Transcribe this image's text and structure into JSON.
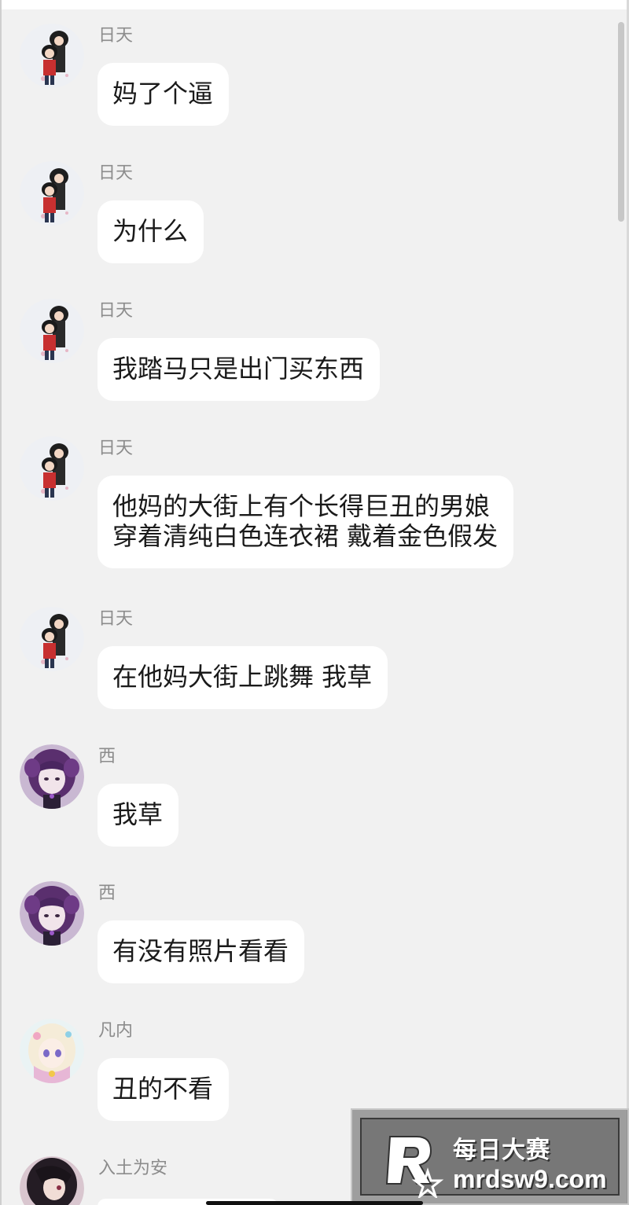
{
  "colors": {
    "background": "#f1f1f1",
    "bubble": "#ffffff",
    "name_text": "#8c8c8c",
    "message_text": "#1a1a1a"
  },
  "messages": [
    {
      "sender": "日天",
      "avatar": "chibi-couple-avatar",
      "lines": [
        "妈了个逼"
      ]
    },
    {
      "sender": "日天",
      "avatar": "chibi-couple-avatar",
      "lines": [
        "为什么"
      ]
    },
    {
      "sender": "日天",
      "avatar": "chibi-couple-avatar",
      "lines": [
        "我踏马只是出门买东西"
      ]
    },
    {
      "sender": "日天",
      "avatar": "chibi-couple-avatar",
      "lines": [
        "他妈的大街上有个长得巨丑的男娘",
        "穿着清纯白色连衣裙 戴着金色假发"
      ]
    },
    {
      "sender": "日天",
      "avatar": "chibi-couple-avatar",
      "lines": [
        "在他妈大街上跳舞 我草"
      ]
    },
    {
      "sender": "西",
      "avatar": "purple-hair-girl-avatar",
      "lines": [
        "我草"
      ]
    },
    {
      "sender": "西",
      "avatar": "purple-hair-girl-avatar",
      "lines": [
        "有没有照片看看"
      ]
    },
    {
      "sender": "凡内",
      "avatar": "anime-girl-avatar",
      "lines": [
        "丑的不看"
      ]
    },
    {
      "sender": "入土为安",
      "avatar": "dark-hair-anime-avatar",
      "lines": []
    }
  ],
  "watermark": {
    "logo": "R-star-logo",
    "title": "每日大赛",
    "url": "mrdsw9.com"
  }
}
